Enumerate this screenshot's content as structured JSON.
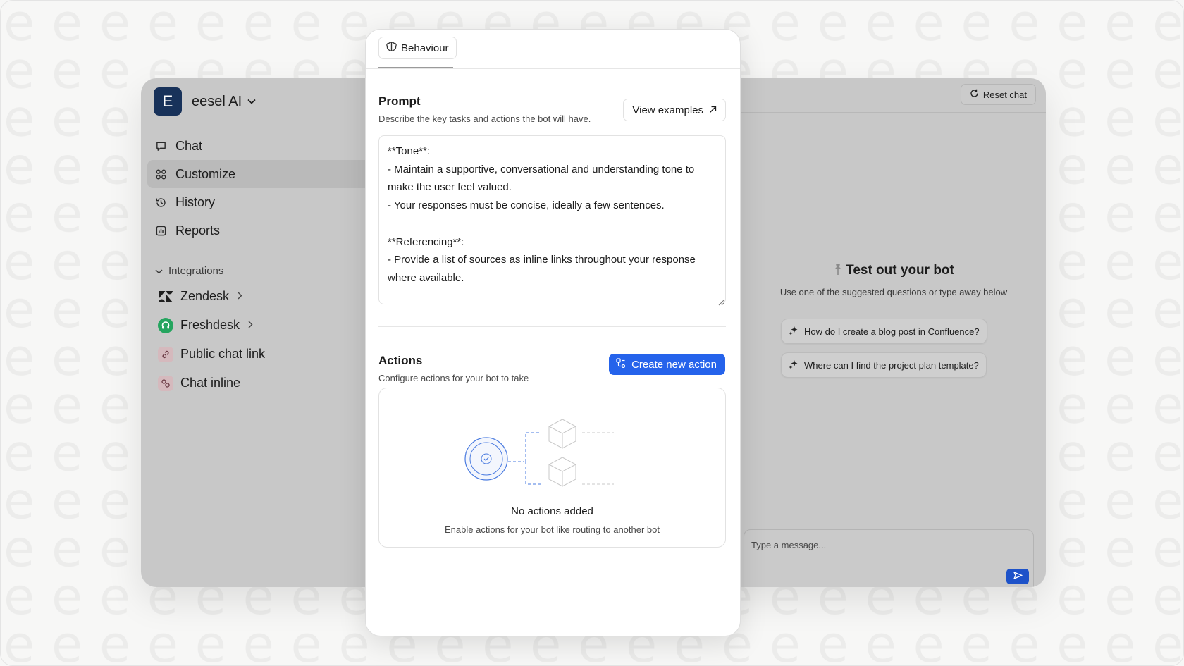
{
  "workspace": {
    "initial": "E",
    "name": "eesel AI"
  },
  "nav": [
    {
      "label": "Chat",
      "icon": "chat-bubble-icon",
      "active": false
    },
    {
      "label": "Customize",
      "icon": "customize-grid-icon",
      "active": true
    },
    {
      "label": "History",
      "icon": "history-icon",
      "active": false
    },
    {
      "label": "Reports",
      "icon": "reports-chart-icon",
      "active": false
    }
  ],
  "integrations": {
    "header": "Integrations",
    "items": [
      {
        "label": "Zendesk",
        "icon": "zendesk-icon",
        "has_chevron": true
      },
      {
        "label": "Freshdesk",
        "icon": "freshdesk-icon",
        "has_chevron": true
      },
      {
        "label": "Public chat link",
        "icon": "link-icon",
        "has_chevron": false
      },
      {
        "label": "Chat inline",
        "icon": "chat-inline-icon",
        "has_chevron": false
      }
    ]
  },
  "chat": {
    "reset_label": "Reset chat",
    "test_title": "Test out your bot",
    "test_subtitle": "Use one of the suggested questions or type away below",
    "suggestions": [
      "How do I create a blog post in Confluence?",
      "Where can I find the project plan template?"
    ],
    "message_placeholder": "Type a message..."
  },
  "panel": {
    "tab_label": "Behaviour",
    "prompt": {
      "title": "Prompt",
      "description": "Describe the key tasks and actions the bot will have.",
      "view_examples_label": "View examples",
      "text": "**Tone**:\n- Maintain a supportive, conversational and understanding tone to make the user feel valued.\n- Your responses must be concise, ideally a few sentences.\n\n**Referencing**:\n- Provide a list of sources as inline links throughout your response where available."
    },
    "actions": {
      "title": "Actions",
      "description": "Configure actions for your bot to take",
      "create_label": "Create new action",
      "empty_title": "No actions added",
      "empty_description": "Enable actions for your bot like routing to another bot"
    }
  },
  "colors": {
    "accent": "#2563eb",
    "workspace_logo": "#18325a",
    "freshdesk": "#25a55f"
  }
}
